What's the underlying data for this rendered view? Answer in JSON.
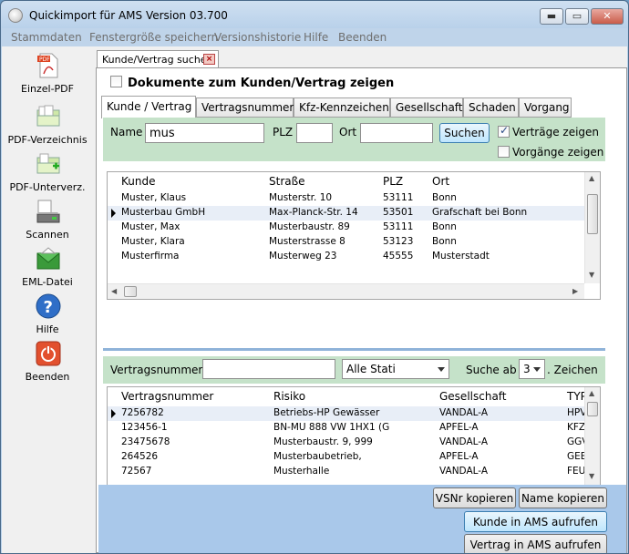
{
  "window": {
    "title": "Quickimport für AMS Version 03.700",
    "controls": {
      "minimize": "▬",
      "maximize": "▭",
      "close": "✕"
    }
  },
  "menu": [
    "Stammdaten",
    "Fenstergröße speichern",
    "Versionshistorie",
    "Hilfe",
    "Beenden"
  ],
  "sidebar": [
    {
      "label": "Einzel-PDF",
      "icon": "pdf-icon"
    },
    {
      "label": "PDF-Verzeichnis",
      "icon": "folder-icon"
    },
    {
      "label": "PDF-Unterverz.",
      "icon": "subfolder-icon"
    },
    {
      "label": "Scannen",
      "icon": "scanner-icon"
    },
    {
      "label": "EML-Datei",
      "icon": "email-icon"
    },
    {
      "label": "Hilfe",
      "icon": "help-icon"
    },
    {
      "label": "Beenden",
      "icon": "power-icon"
    }
  ],
  "doc_tab": {
    "label": "Kunde/Vertrag suchen",
    "close": "×"
  },
  "show_docs": {
    "label": "Dokumente zum Kunden/Vertrag zeigen",
    "checked": false
  },
  "tabs": [
    "Kunde / Vertrag",
    "Vertragsnummer",
    "Kfz-Kennzeichen",
    "Gesellschaft",
    "Schaden",
    "Vorgang"
  ],
  "search": {
    "name_label": "Name",
    "name_value": "mus",
    "plz_label": "PLZ",
    "plz_value": "",
    "ort_label": "Ort",
    "ort_value": "",
    "search_button": "Suchen",
    "show_contracts": {
      "label": "Verträge zeigen",
      "checked": true
    },
    "show_processes": {
      "label": "Vorgänge zeigen",
      "checked": false
    }
  },
  "customers": {
    "columns": [
      "Kunde",
      "Straße",
      "PLZ",
      "Ort"
    ],
    "rows": [
      [
        "Muster, Klaus",
        "Musterstr. 10",
        "53111",
        "Bonn"
      ],
      [
        "Musterbau GmbH",
        "Max-Planck-Str. 14",
        "53501",
        "Grafschaft bei Bonn"
      ],
      [
        "Muster, Max",
        "Musterbaustr. 89",
        "53111",
        "Bonn"
      ],
      [
        "Muster, Klara",
        "Musterstrasse 8",
        "53123",
        "Bonn"
      ],
      [
        "Musterfirma",
        "Musterweg 23",
        "45555",
        "Musterstadt"
      ]
    ],
    "selected_row": 1
  },
  "contract_filter": {
    "label": "Vertragsnummer",
    "value": "",
    "status_select": "Alle Stati",
    "search_from_label": "Suche ab",
    "search_from_value": "3",
    "chars_label": ". Zeichen"
  },
  "contracts": {
    "columns": [
      "Vertragsnummer",
      "Risiko",
      "Gesellschaft",
      "TYP"
    ],
    "rows": [
      [
        "7256782",
        "Betriebs-HP Gewässer",
        "VANDAL-A",
        "HPV"
      ],
      [
        "123456-1",
        "BN-MU 888 VW 1HX1 (G",
        "APFEL-A",
        "KFZ"
      ],
      [
        "23475678",
        "Musterbaustr. 9, 999",
        "VANDAL-A",
        "GGV"
      ],
      [
        "264526",
        "Musterbaubetrieb,",
        "APFEL-A",
        "GEB"
      ],
      [
        "72567",
        "Musterhalle",
        "VANDAL-A",
        "FEU"
      ]
    ],
    "selected_row": 0
  },
  "actions": {
    "copy_vsnr": "VSNr kopieren",
    "copy_name": "Name kopieren",
    "open_customer": "Kunde in AMS aufrufen",
    "open_contract": "Vertrag in AMS aufrufen"
  }
}
